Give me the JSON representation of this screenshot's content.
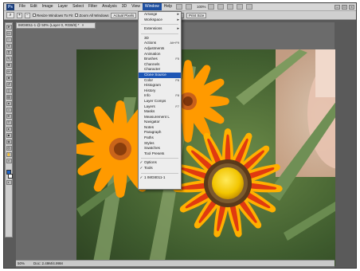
{
  "menubar": {
    "logo": "Ps",
    "items": [
      "File",
      "Edit",
      "Image",
      "Layer",
      "Select",
      "Filter",
      "Analysis",
      "3D",
      "View",
      "Window",
      "Help"
    ],
    "active_item": "Window",
    "zoom": "100%"
  },
  "options": {
    "resize_windows": "Resize Windows To Fit",
    "zoom_all": "Zoom All Windows",
    "actual_pixels": "Actual Pixels",
    "fit_screen": "Fit Screen",
    "fill_screen": "Fill Screen",
    "print_size": "Print Size"
  },
  "document": {
    "tab_title": "IMG8011-1 @ 50% (Layer 0, RGB/8) *",
    "close": "×",
    "zoom": "50%",
    "doc_info": "Doc: 2.49M/4.99M"
  },
  "window_menu": {
    "items": [
      {
        "label": "Arrange",
        "shortcut": "▸",
        "submenu": true
      },
      {
        "label": "Workspace",
        "shortcut": "▸",
        "submenu": true
      },
      {
        "sep": true
      },
      {
        "label": "Extensions",
        "shortcut": "▸",
        "submenu": true
      },
      {
        "sep": true
      },
      {
        "label": "3D",
        "shortcut": ""
      },
      {
        "label": "Actions",
        "shortcut": "Alt+F9"
      },
      {
        "label": "Adjustments",
        "shortcut": ""
      },
      {
        "label": "Animation",
        "shortcut": ""
      },
      {
        "label": "Brushes",
        "shortcut": "F5"
      },
      {
        "label": "Channels",
        "shortcut": ""
      },
      {
        "label": "Character",
        "shortcut": ""
      },
      {
        "label": "Clone Source",
        "shortcut": "",
        "highlight": true
      },
      {
        "label": "Color",
        "shortcut": "F6"
      },
      {
        "label": "Histogram",
        "shortcut": ""
      },
      {
        "label": "History",
        "shortcut": ""
      },
      {
        "label": "Info",
        "shortcut": "F8"
      },
      {
        "label": "Layer Comps",
        "shortcut": ""
      },
      {
        "label": "Layers",
        "shortcut": "F7"
      },
      {
        "label": "Masks",
        "shortcut": ""
      },
      {
        "label": "Measurement Log",
        "shortcut": ""
      },
      {
        "label": "Navigator",
        "shortcut": ""
      },
      {
        "label": "Notes",
        "shortcut": ""
      },
      {
        "label": "Paragraph",
        "shortcut": ""
      },
      {
        "label": "Paths",
        "shortcut": ""
      },
      {
        "label": "Styles",
        "shortcut": ""
      },
      {
        "label": "Swatches",
        "shortcut": ""
      },
      {
        "label": "Tool Presets",
        "shortcut": ""
      },
      {
        "sep": true
      },
      {
        "label": "Options",
        "shortcut": "",
        "checked": true
      },
      {
        "label": "Tools",
        "shortcut": "",
        "checked": true
      },
      {
        "sep": true
      },
      {
        "label": "1 IMG8011-1",
        "shortcut": "",
        "checked": true
      }
    ]
  },
  "colors": {
    "foreground": "#1d63c7",
    "background": "#ffffff",
    "menu_highlight": "#1d56b5"
  }
}
